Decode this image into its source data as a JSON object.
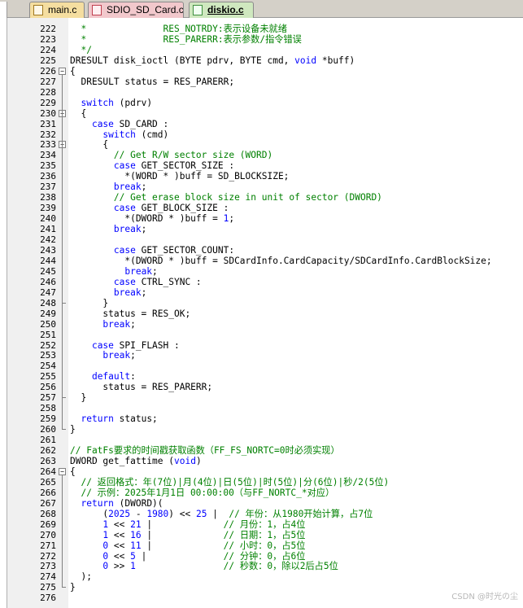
{
  "tabs": [
    {
      "label": "main.c",
      "active": false
    },
    {
      "label": "SDIO_SD_Card.c",
      "active": false
    },
    {
      "label": "diskio.c",
      "active": true
    }
  ],
  "lines": [
    {
      "n": "222",
      "fold": "",
      "segs": [
        {
          "t": "  *              RES_NOTRDY:表示设备未就绪",
          "c": "cm"
        }
      ]
    },
    {
      "n": "223",
      "fold": "",
      "segs": [
        {
          "t": "  *              RES_PARERR:表示参数/指令错误",
          "c": "cm"
        }
      ]
    },
    {
      "n": "224",
      "fold": "",
      "segs": [
        {
          "t": "  */",
          "c": "cm"
        }
      ]
    },
    {
      "n": "225",
      "fold": "",
      "segs": [
        {
          "t": "DRESULT disk_ioctl (BYTE pdrv, BYTE cmd, ",
          "c": ""
        },
        {
          "t": "void",
          "c": "kw"
        },
        {
          "t": " *buff)",
          "c": ""
        }
      ]
    },
    {
      "n": "226",
      "fold": "open",
      "segs": [
        {
          "t": "{",
          "c": ""
        }
      ]
    },
    {
      "n": "227",
      "fold": "",
      "segs": [
        {
          "t": "  DRESULT status = RES_PARERR;",
          "c": ""
        }
      ]
    },
    {
      "n": "228",
      "fold": "",
      "segs": []
    },
    {
      "n": "229",
      "fold": "",
      "segs": [
        {
          "t": "  ",
          "c": ""
        },
        {
          "t": "switch",
          "c": "kw"
        },
        {
          "t": " (pdrv)",
          "c": ""
        }
      ]
    },
    {
      "n": "230",
      "fold": "open",
      "segs": [
        {
          "t": "  {",
          "c": ""
        }
      ]
    },
    {
      "n": "231",
      "fold": "",
      "segs": [
        {
          "t": "    ",
          "c": ""
        },
        {
          "t": "case",
          "c": "kw"
        },
        {
          "t": " SD_CARD :",
          "c": ""
        }
      ]
    },
    {
      "n": "232",
      "fold": "",
      "segs": [
        {
          "t": "      ",
          "c": ""
        },
        {
          "t": "switch",
          "c": "kw"
        },
        {
          "t": " (cmd)",
          "c": ""
        }
      ]
    },
    {
      "n": "233",
      "fold": "open",
      "segs": [
        {
          "t": "      {",
          "c": ""
        }
      ]
    },
    {
      "n": "234",
      "fold": "",
      "segs": [
        {
          "t": "        // Get R/W sector size (WORD)",
          "c": "cm"
        }
      ]
    },
    {
      "n": "235",
      "fold": "",
      "segs": [
        {
          "t": "        ",
          "c": ""
        },
        {
          "t": "case",
          "c": "kw"
        },
        {
          "t": " GET_SECTOR_SIZE :",
          "c": ""
        }
      ]
    },
    {
      "n": "236",
      "fold": "",
      "segs": [
        {
          "t": "          *(WORD * )buff = SD_BLOCKSIZE;",
          "c": ""
        }
      ]
    },
    {
      "n": "237",
      "fold": "",
      "segs": [
        {
          "t": "        ",
          "c": ""
        },
        {
          "t": "break",
          "c": "kw"
        },
        {
          "t": ";",
          "c": ""
        }
      ]
    },
    {
      "n": "238",
      "fold": "",
      "segs": [
        {
          "t": "        // Get erase block size in unit of sector (DWORD)",
          "c": "cm"
        }
      ]
    },
    {
      "n": "239",
      "fold": "",
      "segs": [
        {
          "t": "        ",
          "c": ""
        },
        {
          "t": "case",
          "c": "kw"
        },
        {
          "t": " GET_BLOCK_SIZE :",
          "c": ""
        }
      ]
    },
    {
      "n": "240",
      "fold": "",
      "segs": [
        {
          "t": "          *(DWORD * )buff = ",
          "c": ""
        },
        {
          "t": "1",
          "c": "kw"
        },
        {
          "t": ";",
          "c": ""
        }
      ]
    },
    {
      "n": "241",
      "fold": "",
      "segs": [
        {
          "t": "        ",
          "c": ""
        },
        {
          "t": "break",
          "c": "kw"
        },
        {
          "t": ";",
          "c": ""
        }
      ]
    },
    {
      "n": "242",
      "fold": "",
      "segs": []
    },
    {
      "n": "243",
      "fold": "",
      "segs": [
        {
          "t": "        ",
          "c": ""
        },
        {
          "t": "case",
          "c": "kw"
        },
        {
          "t": " GET_SECTOR_COUNT:",
          "c": ""
        }
      ]
    },
    {
      "n": "244",
      "fold": "",
      "segs": [
        {
          "t": "          *(DWORD * )buff = SDCardInfo.CardCapacity/SDCardInfo.CardBlockSize;",
          "c": ""
        }
      ]
    },
    {
      "n": "245",
      "fold": "",
      "segs": [
        {
          "t": "          ",
          "c": ""
        },
        {
          "t": "break",
          "c": "kw"
        },
        {
          "t": ";",
          "c": ""
        }
      ]
    },
    {
      "n": "246",
      "fold": "",
      "segs": [
        {
          "t": "        ",
          "c": ""
        },
        {
          "t": "case",
          "c": "kw"
        },
        {
          "t": " CTRL_SYNC :",
          "c": ""
        }
      ]
    },
    {
      "n": "247",
      "fold": "",
      "segs": [
        {
          "t": "        ",
          "c": ""
        },
        {
          "t": "break",
          "c": "kw"
        },
        {
          "t": ";",
          "c": ""
        }
      ]
    },
    {
      "n": "248",
      "fold": "end",
      "segs": [
        {
          "t": "      }",
          "c": ""
        }
      ]
    },
    {
      "n": "249",
      "fold": "",
      "segs": [
        {
          "t": "      status = RES_OK;",
          "c": ""
        }
      ]
    },
    {
      "n": "250",
      "fold": "",
      "segs": [
        {
          "t": "      ",
          "c": ""
        },
        {
          "t": "break",
          "c": "kw"
        },
        {
          "t": ";",
          "c": ""
        }
      ]
    },
    {
      "n": "251",
      "fold": "",
      "segs": []
    },
    {
      "n": "252",
      "fold": "",
      "segs": [
        {
          "t": "    ",
          "c": ""
        },
        {
          "t": "case",
          "c": "kw"
        },
        {
          "t": " SPI_FLASH :",
          "c": ""
        }
      ]
    },
    {
      "n": "253",
      "fold": "",
      "segs": [
        {
          "t": "      ",
          "c": ""
        },
        {
          "t": "break",
          "c": "kw"
        },
        {
          "t": ";",
          "c": ""
        }
      ]
    },
    {
      "n": "254",
      "fold": "",
      "segs": []
    },
    {
      "n": "255",
      "fold": "",
      "segs": [
        {
          "t": "    ",
          "c": ""
        },
        {
          "t": "default",
          "c": "kw"
        },
        {
          "t": ":",
          "c": ""
        }
      ]
    },
    {
      "n": "256",
      "fold": "",
      "segs": [
        {
          "t": "      status = RES_PARERR;",
          "c": ""
        }
      ]
    },
    {
      "n": "257",
      "fold": "end",
      "segs": [
        {
          "t": "  }",
          "c": ""
        }
      ]
    },
    {
      "n": "258",
      "fold": "",
      "segs": []
    },
    {
      "n": "259",
      "fold": "",
      "segs": [
        {
          "t": "  ",
          "c": ""
        },
        {
          "t": "return",
          "c": "kw"
        },
        {
          "t": " status;",
          "c": ""
        }
      ]
    },
    {
      "n": "260",
      "fold": "end",
      "segs": [
        {
          "t": "}",
          "c": ""
        }
      ]
    },
    {
      "n": "261",
      "fold": "",
      "segs": []
    },
    {
      "n": "262",
      "fold": "",
      "segs": [
        {
          "t": "// FatFs要求的时间戳获取函数（FF_FS_NORTC=0时必须实现）",
          "c": "cm"
        }
      ]
    },
    {
      "n": "263",
      "fold": "",
      "segs": [
        {
          "t": "DWORD get_fattime (",
          "c": ""
        },
        {
          "t": "void",
          "c": "kw"
        },
        {
          "t": ")",
          "c": ""
        }
      ]
    },
    {
      "n": "264",
      "fold": "open",
      "segs": [
        {
          "t": "{",
          "c": ""
        }
      ]
    },
    {
      "n": "265",
      "fold": "",
      "segs": [
        {
          "t": "  // 返回格式：年(7位)|月(4位)|日(5位)|时(5位)|分(6位)|秒/2(5位)",
          "c": "cm"
        }
      ]
    },
    {
      "n": "266",
      "fold": "",
      "segs": [
        {
          "t": "  // 示例：2025年1月1日 00:00:00（与FF_NORTC_*对应）",
          "c": "cm"
        }
      ]
    },
    {
      "n": "267",
      "fold": "",
      "segs": [
        {
          "t": "  ",
          "c": ""
        },
        {
          "t": "return",
          "c": "kw"
        },
        {
          "t": " (DWORD)(",
          "c": ""
        }
      ]
    },
    {
      "n": "268",
      "fold": "",
      "segs": [
        {
          "t": "      (",
          "c": ""
        },
        {
          "t": "2025",
          "c": "kw"
        },
        {
          "t": " - ",
          "c": ""
        },
        {
          "t": "1980",
          "c": "kw"
        },
        {
          "t": ") << ",
          "c": ""
        },
        {
          "t": "25",
          "c": "kw"
        },
        {
          "t": " |  ",
          "c": ""
        },
        {
          "t": "// 年份：从1980开始计算，占7位",
          "c": "cm"
        }
      ]
    },
    {
      "n": "269",
      "fold": "",
      "segs": [
        {
          "t": "      ",
          "c": ""
        },
        {
          "t": "1",
          "c": "kw"
        },
        {
          "t": " << ",
          "c": ""
        },
        {
          "t": "21",
          "c": "kw"
        },
        {
          "t": " |             ",
          "c": ""
        },
        {
          "t": "// 月份：1，占4位",
          "c": "cm"
        }
      ]
    },
    {
      "n": "270",
      "fold": "",
      "segs": [
        {
          "t": "      ",
          "c": ""
        },
        {
          "t": "1",
          "c": "kw"
        },
        {
          "t": " << ",
          "c": ""
        },
        {
          "t": "16",
          "c": "kw"
        },
        {
          "t": " |             ",
          "c": ""
        },
        {
          "t": "// 日期：1，占5位",
          "c": "cm"
        }
      ]
    },
    {
      "n": "271",
      "fold": "",
      "segs": [
        {
          "t": "      ",
          "c": ""
        },
        {
          "t": "0",
          "c": "kw"
        },
        {
          "t": " << ",
          "c": ""
        },
        {
          "t": "11",
          "c": "kw"
        },
        {
          "t": " |             ",
          "c": ""
        },
        {
          "t": "// 小时：0，占5位",
          "c": "cm"
        }
      ]
    },
    {
      "n": "272",
      "fold": "",
      "segs": [
        {
          "t": "      ",
          "c": ""
        },
        {
          "t": "0",
          "c": "kw"
        },
        {
          "t": " << ",
          "c": ""
        },
        {
          "t": "5",
          "c": "kw"
        },
        {
          "t": " |              ",
          "c": ""
        },
        {
          "t": "// 分钟：0，占6位",
          "c": "cm"
        }
      ]
    },
    {
      "n": "273",
      "fold": "",
      "segs": [
        {
          "t": "      ",
          "c": ""
        },
        {
          "t": "0",
          "c": "kw"
        },
        {
          "t": " >> ",
          "c": ""
        },
        {
          "t": "1",
          "c": "kw"
        },
        {
          "t": "                ",
          "c": ""
        },
        {
          "t": "// 秒数：0，除以2后占5位",
          "c": "cm"
        }
      ]
    },
    {
      "n": "274",
      "fold": "",
      "segs": [
        {
          "t": "  );",
          "c": ""
        }
      ]
    },
    {
      "n": "275",
      "fold": "end",
      "segs": [
        {
          "t": "}",
          "c": ""
        }
      ]
    },
    {
      "n": "276",
      "fold": "",
      "segs": []
    }
  ],
  "watermark": "CSDN @时光の尘"
}
